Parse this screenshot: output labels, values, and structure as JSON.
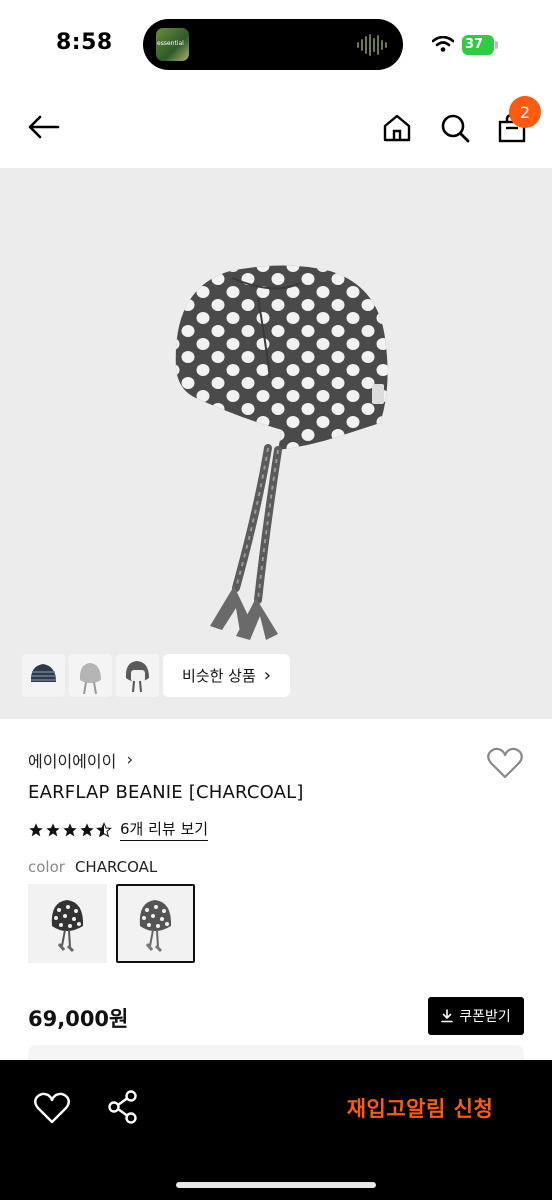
{
  "status_bar": {
    "time": "8:58",
    "island_thumb_text": "essential",
    "battery_level": "37"
  },
  "nav": {
    "back_icon": "arrow-left-icon",
    "home_icon": "home-icon",
    "search_icon": "search-icon",
    "bag_icon": "shopping-bag-icon",
    "cart_count": "2",
    "badge_color": "#ff5b10"
  },
  "gallery": {
    "similar_label": "비슷한 상품",
    "similar_chevron": "›"
  },
  "product": {
    "brand": "에이이에이이",
    "brand_chevron": "›",
    "title": "EARFLAP BEANIE [CHARCOAL]",
    "rating": 4.5,
    "review_link": "6개 리뷰 보기",
    "color_label": "color",
    "color_value": "CHARCOAL",
    "selected_swatch_index": 1,
    "price": "69,000원",
    "coupon_label": "쿠폰받기"
  },
  "bottom_bar": {
    "wish_icon": "heart-outline-icon",
    "share_icon": "share-icon",
    "restock_label": "재입고알림 신청",
    "accent_color": "#ff5b10"
  }
}
